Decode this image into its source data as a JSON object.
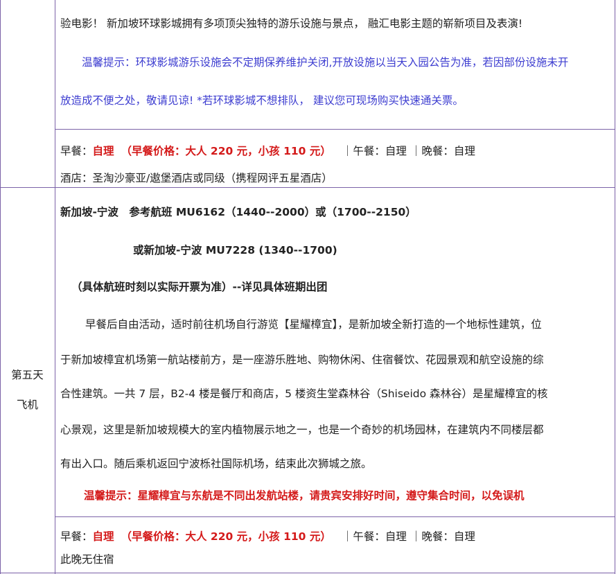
{
  "row_top": {
    "line1": "验电影！ 新加坡环球影城拥有多项顶尖独特的游乐设施与景点， 融汇电影主题的崭新项目及表演!",
    "tip_line1": "温馨提示：环球影城游乐设施会不定期保养维护关闭,开放设施以当天入园公告为准，若因部份设施未开",
    "tip_line2": "放造成不便之处，敬请见谅! *若环球影城不想排队， 建议您可现场购买快速通关票。"
  },
  "meals_1": {
    "breakfast_label": "早餐：",
    "breakfast_value": "自理",
    "breakfast_price": "（早餐价格：大人 220 元，小孩 110 元）",
    "lunch": "｜午餐：自理",
    "dinner": "｜晚餐：自理"
  },
  "hotel_1": "酒店：圣淘沙豪亚/遨堡酒店或同级（携程网评五星酒店）",
  "day5": {
    "day_label": "第五天",
    "transport": "飞机",
    "flight1": "新加坡-宁波　参考航班 MU6162（1440--2000）或（1700--2150）",
    "flight2": "或新加坡-宁波 MU7228 (1340--1700)",
    "flight_note": "（具体航班时刻以实际开票为准）--详见具体班期出团",
    "para": [
      "早餐后自由活动，适时前往机场自行游览【星耀樟宜】，是新加坡全新打造的一个地标性建筑，位",
      "于新加坡樟宜机场第一航站楼前方，是一座游乐胜地、购物休闲、住宿餐饮、花园景观和航空设施的综",
      "合性建筑。一共 7 层，B2-4 楼是餐厅和商店，5 楼资生堂森林谷（Shiseido 森林谷）是星耀樟宜的核",
      "心景观，这里是新加坡规模大的室内植物展示地之一，也是一个奇妙的机场园林，在建筑内不同楼层都",
      "有出入口。随后乘机返回宁波栎社国际机场，结束此次狮城之旅。"
    ],
    "warning": "温馨提示：星耀樟宜与东航是不同出发航站楼，请贵宾安排好时间，遵守集合时间，以免误机"
  },
  "meals_2": {
    "breakfast_label": "早餐：",
    "breakfast_value": "自理",
    "breakfast_price": "（早餐价格：大人 220 元，小孩 110 元）",
    "lunch": "｜午餐：自理",
    "dinner": "｜晚餐：自理"
  },
  "hotel_2": "此晚无住宿",
  "colors": {
    "border": "#7b62a8",
    "tip_blue": "#3d3dd0",
    "warning_red": "#d41a1a"
  }
}
